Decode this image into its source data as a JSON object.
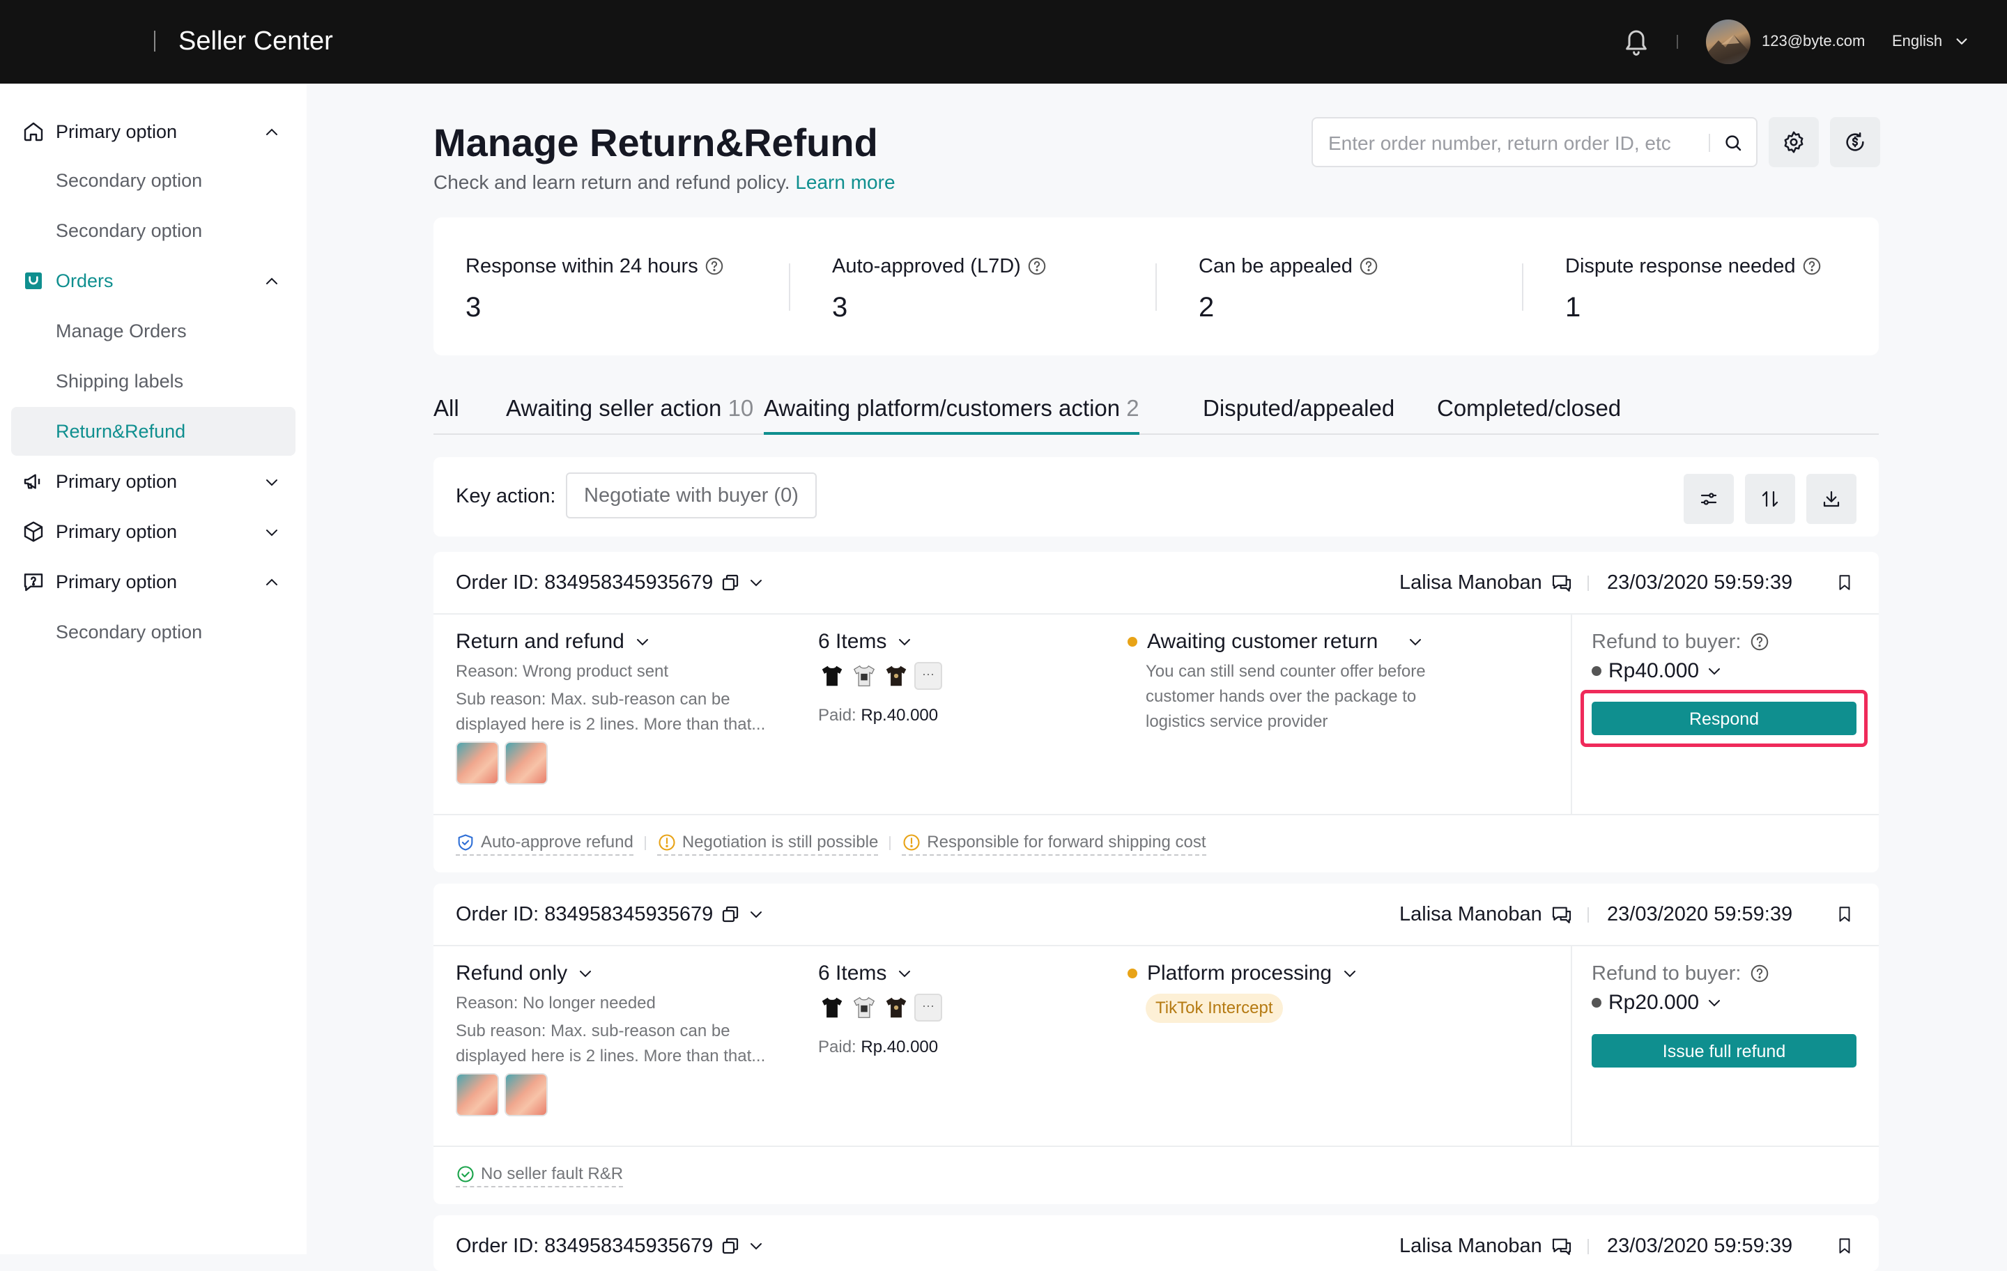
{
  "app": {
    "brand": "Seller Center"
  },
  "topbar": {
    "email": "123@byte.com",
    "language": "English"
  },
  "sidebar": {
    "groups": [
      {
        "label": "Primary option",
        "children": [
          "Secondary option",
          "Secondary option"
        ]
      },
      {
        "label": "Orders",
        "children": [
          "Manage Orders",
          "Shipping labels",
          "Return&Refund"
        ]
      },
      {
        "label": "Primary option"
      },
      {
        "label": "Primary option"
      },
      {
        "label": "Primary option",
        "children": [
          "Secondary option"
        ]
      }
    ],
    "active": "Return&Refund"
  },
  "page": {
    "title": "Manage Return&Refund",
    "subtitle": "Check and learn return and refund policy.",
    "learn_more": "Learn more",
    "search_placeholder": "Enter order number, return order ID, etc"
  },
  "stats": [
    {
      "label": "Response within 24 hours",
      "value": "3"
    },
    {
      "label": "Auto-approved (L7D)",
      "value": "3"
    },
    {
      "label": "Can be appealed",
      "value": "2"
    },
    {
      "label": "Dispute response needed",
      "value": "1"
    }
  ],
  "tabs": [
    {
      "label": "All",
      "count": ""
    },
    {
      "label": "Awaiting seller action",
      "count": "10"
    },
    {
      "label": "Awaiting platform/customers action",
      "count": "2"
    },
    {
      "label": "Disputed/appealed",
      "count": ""
    },
    {
      "label": "Completed/closed",
      "count": ""
    }
  ],
  "active_tab": "Awaiting platform/customers action",
  "filter": {
    "key_action_label": "Key action:",
    "chip": "Negotiate with buyer (0)"
  },
  "orders": [
    {
      "order_id": "Order ID: 834958345935679",
      "buyer": "Lalisa Manoban",
      "date": "23/03/2020 59:59:39",
      "type": "Return and refund",
      "reason": "Reason: Wrong product sent",
      "sub_reason": "Sub reason: Max. sub-reason can be displayed here is 2 lines. More than that...",
      "items": "6 Items",
      "paid_label": "Paid:",
      "paid_value": "Rp.40.000",
      "status": "Awaiting customer return",
      "status_desc": "You can still send counter offer before customer hands over the package to logistics service provider",
      "refund_label": "Refund to buyer:",
      "refund_amount": "Rp40.000",
      "action": "Respond",
      "tags": [
        "Auto-approve refund",
        "Negotiation is still possible",
        "Responsible for forward shipping cost"
      ]
    },
    {
      "order_id": "Order ID: 834958345935679",
      "buyer": "Lalisa Manoban",
      "date": "23/03/2020 59:59:39",
      "type": "Refund only",
      "reason": "Reason: No longer needed",
      "sub_reason": "Sub reason: Max. sub-reason can be displayed here is 2 lines. More than that...",
      "items": "6 Items",
      "paid_label": "Paid:",
      "paid_value": "Rp.40.000",
      "status": "Platform processing",
      "badge": "TikTok Intercept",
      "refund_label": "Refund to buyer:",
      "refund_amount": "Rp20.000",
      "action": "Issue full refund",
      "tags": [
        "No seller fault R&R"
      ]
    },
    {
      "order_id": "Order ID: 834958345935679",
      "buyer": "Lalisa Manoban",
      "date": "23/03/2020 59:59:39"
    }
  ],
  "colors": {
    "accent": "#0f8f8f",
    "highlight": "#ef2a5a",
    "status_dot": "#e8a317",
    "topbar": "#121212"
  }
}
